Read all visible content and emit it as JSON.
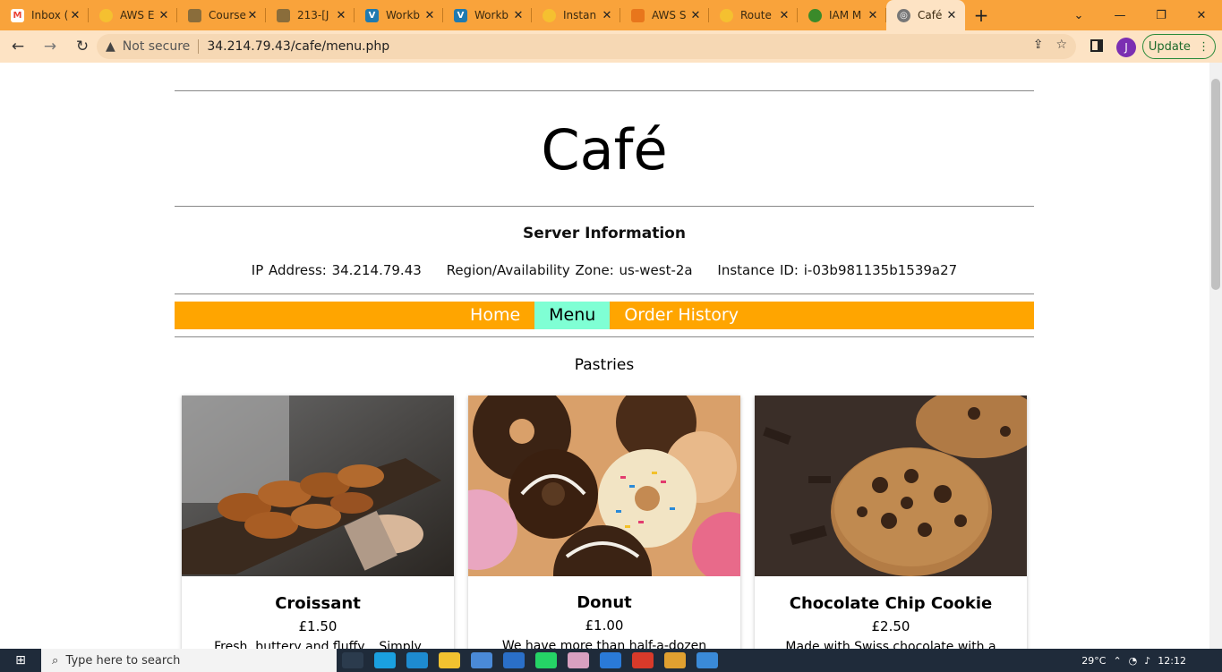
{
  "browser": {
    "tabs": [
      {
        "title": "Inbox (",
        "icon": "gmail-icon",
        "color": "#ea4335"
      },
      {
        "title": "AWS E",
        "icon": "aws-icon",
        "color": "#f5c030"
      },
      {
        "title": "Course",
        "icon": "course-icon",
        "color": "#8a6d3b"
      },
      {
        "title": "213-[J",
        "icon": "course-icon",
        "color": "#8a6d3b"
      },
      {
        "title": "Workb",
        "icon": "vocareum-icon",
        "color": "#1f7ab0"
      },
      {
        "title": "Workb",
        "icon": "vocareum-icon",
        "color": "#1f7ab0"
      },
      {
        "title": "Instan",
        "icon": "ec2-icon",
        "color": "#f5c030"
      },
      {
        "title": "AWS S",
        "icon": "aws-s3-icon",
        "color": "#e8761c"
      },
      {
        "title": "Route",
        "icon": "route53-icon",
        "color": "#f5c030"
      },
      {
        "title": "IAM M",
        "icon": "iam-icon",
        "color": "#3a8a2a"
      },
      {
        "title": "Café M",
        "icon": "globe-icon",
        "color": "#555555",
        "active": true
      }
    ],
    "url_warning": "Not secure",
    "url": "34.214.79.43/cafe/menu.php",
    "profile_initial": "J",
    "update_label": "Update"
  },
  "page": {
    "site_title": "Café",
    "server_heading": "Server Information",
    "ip_label": "IP Address: 34.214.79.43",
    "region_label": "Region/Availability Zone: us-west-2a",
    "instance_label": "Instance ID: i-03b981135b1539a27",
    "nav": [
      {
        "label": "Home",
        "current": false
      },
      {
        "label": "Menu",
        "current": true
      },
      {
        "label": "Order History",
        "current": false
      }
    ],
    "section_title": "Pastries",
    "products": [
      {
        "name": "Croissant",
        "price": "£1.50",
        "desc": "Fresh, buttery and fluffy... Simply"
      },
      {
        "name": "Donut",
        "price": "£1.00",
        "desc": "We have more than half-a-dozen"
      },
      {
        "name": "Chocolate Chip Cookie",
        "price": "£2.50",
        "desc": "Made with Swiss chocolate with a"
      }
    ]
  },
  "taskbar": {
    "search_placeholder": "Type here to search",
    "temperature": "29°C",
    "time": "12:12"
  },
  "colors": {
    "tab_strip": "#f9a33b",
    "toolbar": "#fde3c4",
    "nav_bar": "#ffa500",
    "nav_current": "#7fffd4"
  }
}
